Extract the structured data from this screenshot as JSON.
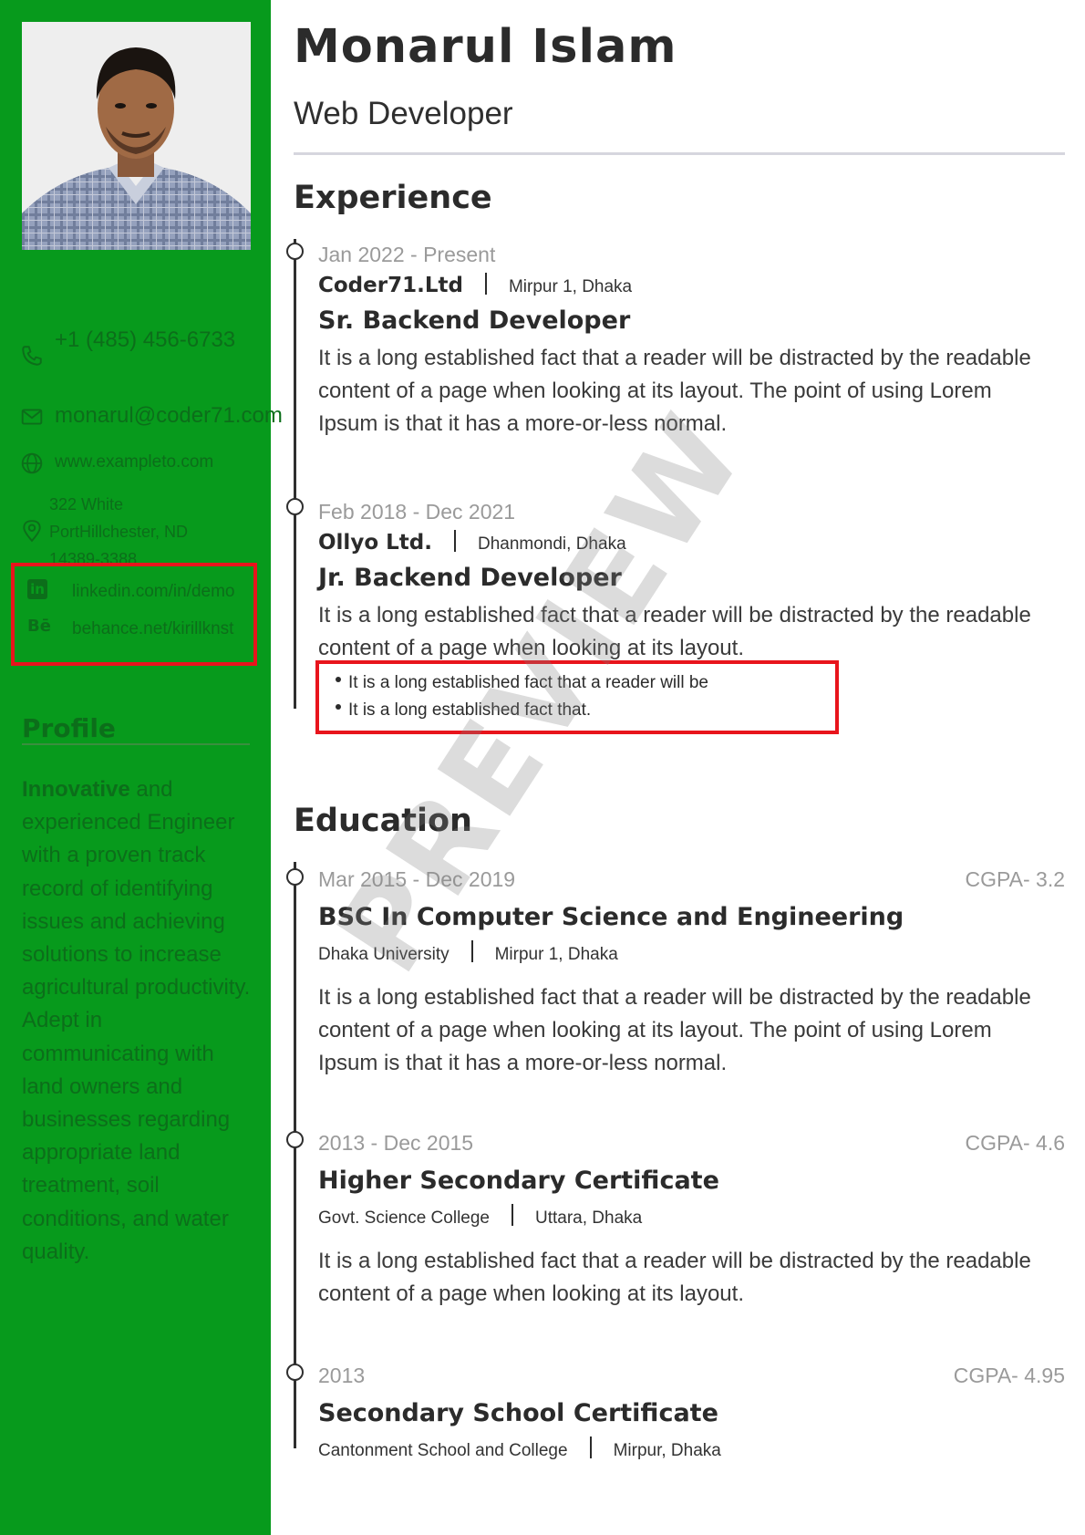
{
  "header": {
    "name": "Monarul Islam",
    "role": "Web Developer"
  },
  "sidebar": {
    "photo_icon": "profile-photo",
    "contacts": {
      "phone": "+1 (485) 456-6733",
      "email": "monarul@coder71.com",
      "website": "www.exampleto.com",
      "address": "322 White PortHillchester, ND 14389-3388"
    },
    "social": {
      "linkedin_icon": "linkedin-icon",
      "linkedin": "linkedin.com/in/demo",
      "behance_icon": "behance-icon",
      "behance": "behance.net/kirillknst"
    },
    "profile": {
      "title": "Profile",
      "lead": "Innovative",
      "text": " and experienced Engineer with a proven track record of identifying issues and achieving solutions to increase agricultural productivity. Adept in communicating with land owners and businesses regarding appropriate land treatment, soil conditions, and water quality."
    }
  },
  "experience": {
    "title": "Experience",
    "items": [
      {
        "date": "Jan 2022 - Present",
        "company": "Coder71.Ltd",
        "location": "Mirpur 1, Dhaka",
        "position": "Sr. Backend Developer",
        "description": "It is a long established fact that a reader will be distracted by the readable content of a page when looking at its layout. The point of using Lorem Ipsum is that it has a more-or-less normal."
      },
      {
        "date": "Feb 2018 - Dec 2021",
        "company": "Ollyo Ltd.",
        "location": "Dhanmondi, Dhaka",
        "position": "Jr. Backend Developer",
        "description": "It is a long established fact that a reader will be distracted by the readable content of a page when looking at its layout.",
        "bullets": [
          "It is a long established fact that a reader will be",
          "It is a long established fact that."
        ]
      }
    ]
  },
  "education": {
    "title": "Education",
    "items": [
      {
        "date": "Mar 2015 - Dec 2019",
        "cgpa": "CGPA- 3.2",
        "degree": "BSC In Computer Science and Engineering",
        "institution": "Dhaka University",
        "location": "Mirpur 1, Dhaka",
        "description": "It is a long established fact that a reader will be distracted by the readable content of a page when looking at its layout. The point of using Lorem Ipsum is that it has a more-or-less normal."
      },
      {
        "date": "2013 - Dec 2015",
        "cgpa": "CGPA- 4.6",
        "degree": "Higher Secondary Certificate",
        "institution": "Govt. Science College",
        "location": "Uttara, Dhaka",
        "description": "It is a long established fact that a reader will be distracted by the readable content of a page when looking at its layout."
      },
      {
        "date": "2013",
        "cgpa": "CGPA- 4.95",
        "degree": "Secondary School Certificate",
        "institution": "Cantonment School and College",
        "location": "Mirpur, Dhaka"
      }
    ]
  },
  "watermark": "PREVIEW",
  "colors": {
    "sidebar_bg": "#079a1c",
    "sidebar_text": "#0c6e1a",
    "highlight_border": "#e8141c",
    "heading": "#2b2b2b",
    "muted": "#9a9a9a"
  }
}
